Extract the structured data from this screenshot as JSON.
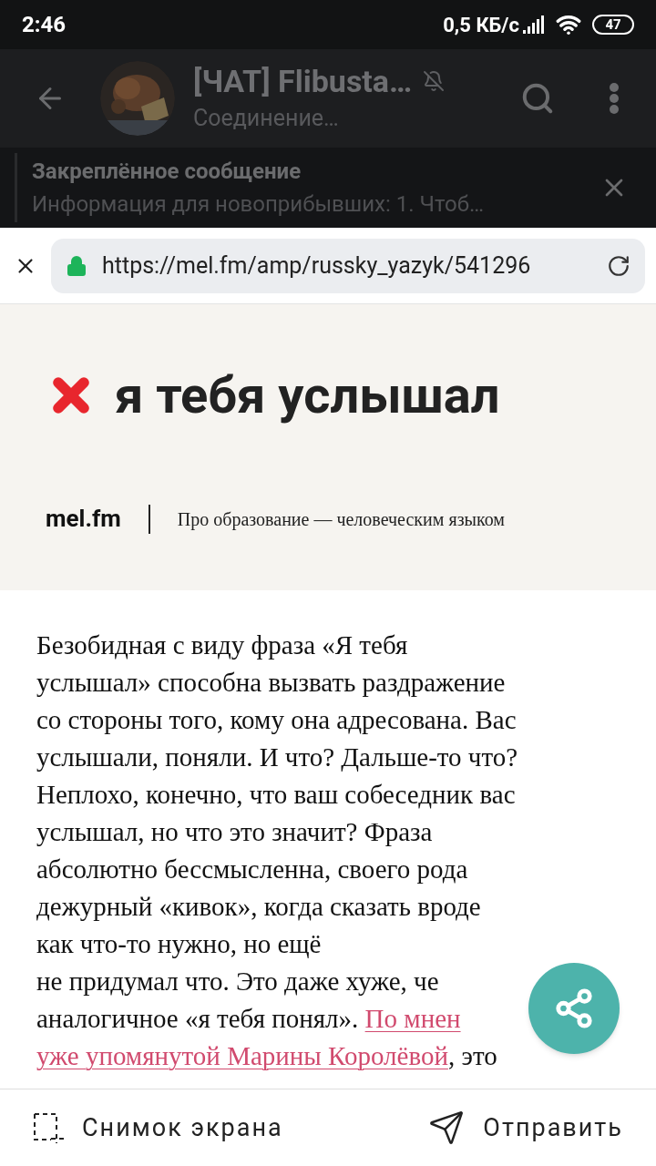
{
  "status_bar": {
    "time": "2:46",
    "speed": "0,5 КБ/с",
    "battery": "47"
  },
  "chat_header": {
    "title": "[ЧАТ] Flibusta…",
    "subtitle": "Соединение…",
    "muted": true
  },
  "pinned_message": {
    "title": "Закреплённое сообщение",
    "text": "Информация для новоприбывших:  1. Чтоб…"
  },
  "browser_bar": {
    "url": "https://mel.fm/amp/russky_yazyk/541296",
    "secure": true
  },
  "banner": {
    "headline": "я тебя услышал",
    "logo": "mel.fm",
    "tagline": "Про образование — человеческим языком"
  },
  "article": {
    "lines": [
      [
        {
          "kind": "text",
          "text": "Безобидная с виду фраза «Я тебя"
        }
      ],
      [
        {
          "kind": "text",
          "text": "услышал» способна вызвать раздражение"
        }
      ],
      [
        {
          "kind": "text",
          "text": "со стороны того, кому она адресована. Вас"
        }
      ],
      [
        {
          "kind": "text",
          "text": "услышали, поняли. И что? Дальше-то что?"
        }
      ],
      [
        {
          "kind": "text",
          "text": "Неплохо, конечно, что ваш собеседник вас"
        }
      ],
      [
        {
          "kind": "text",
          "text": "услышал, но что это значит? Фраза"
        }
      ],
      [
        {
          "kind": "text",
          "text": "абсолютно бессмысленна, своего рода"
        }
      ],
      [
        {
          "kind": "text",
          "text": "дежурный «кивок», когда сказать вроде"
        }
      ],
      [
        {
          "kind": "text",
          "text": "как что-то нужно, но ещё"
        }
      ],
      [
        {
          "kind": "text",
          "text": "не придумал что. Это даже хуже, че"
        }
      ],
      [
        {
          "kind": "text",
          "text": "аналогичное «я тебя понял». "
        },
        {
          "kind": "link",
          "text": "По мнен"
        }
      ],
      [
        {
          "kind": "link",
          "text": "уже упомянутой Марины Королёвой"
        },
        {
          "kind": "text",
          "text": ", это"
        }
      ]
    ]
  },
  "bottom_actions": [
    {
      "kind": "screenshot",
      "label": "Снимок экрана"
    },
    {
      "kind": "send",
      "label": "Отправить"
    }
  ]
}
